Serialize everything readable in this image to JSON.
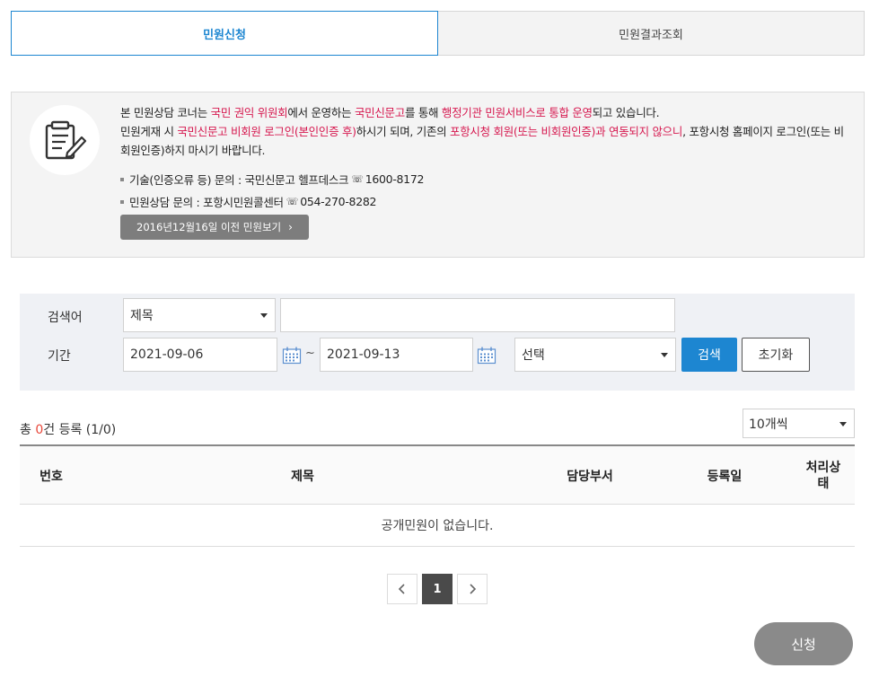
{
  "tabs": [
    {
      "label": "민원신청",
      "active": true
    },
    {
      "label": "민원결과조회",
      "active": false
    }
  ],
  "info": {
    "p1_a": "본 민원상담 코너는 ",
    "p1_b": "국민 권익 위원회",
    "p1_c": "에서 운영하는 ",
    "p1_d": "국민신문고",
    "p1_e": "를 통해 ",
    "p1_f": "행정기관 민원서비스로 통합 운영",
    "p1_g": "되고 있습니다.",
    "p2_a": "민원게재 시 ",
    "p2_b": "국민신문고 비회원 로그인(본인인증 후)",
    "p2_c": "하시기 되며, 기존의 ",
    "p2_d": "포항시청 회원(또는 비회원인증)과 연동되지 않으니",
    "p2_e": ", 포항시청 홈페이지 로그인(또는 비회원인증)하지 마시기 바랍니다.",
    "tech_label": "기술(인증오류 등) 문의 : 국민신문고 헬프데스크",
    "tech_phone": "1600-8172",
    "consult_label": "민원상담 문의 : 포항시민원콜센터",
    "consult_phone": "054-270-8282",
    "old_button": "2016년12월16일 이전 민원보기"
  },
  "search": {
    "keyword_label": "검색어",
    "period_label": "기간",
    "field_select": "제목",
    "keyword_value": "",
    "date_from": "2021-09-06",
    "tilde": "~",
    "date_to": "2021-09-13",
    "status_select": "선택",
    "search_button": "검색",
    "reset_button": "초기화"
  },
  "list": {
    "count_prefix": "총 ",
    "count": "0",
    "count_suffix": "건 등록 (1/0)",
    "per_page": "10개씩",
    "columns": [
      "번호",
      "제목",
      "담당부서",
      "등록일",
      "처리상태"
    ],
    "empty_message": "공개민원이 없습니다."
  },
  "pagination": {
    "current": "1"
  },
  "apply_button": "신청",
  "colors": {
    "accent": "#1d86d1",
    "highlight": "#d6184f",
    "count": "#e8483b"
  }
}
